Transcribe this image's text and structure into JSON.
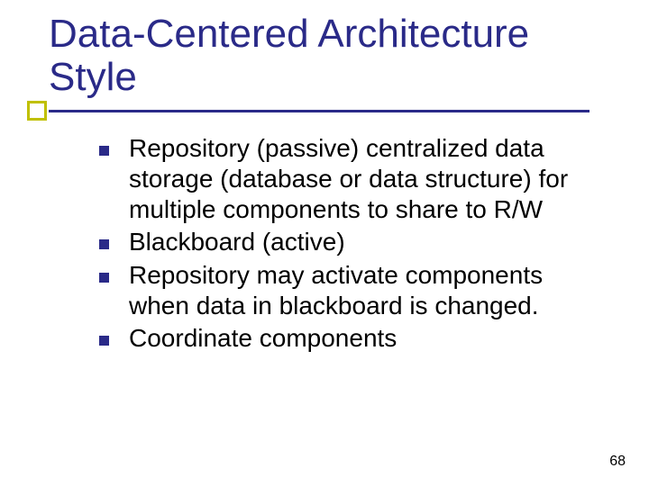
{
  "title": "Data-Centered Architecture Style",
  "bullets": [
    "Repository (passive) centralized data storage (database or data structure) for multiple components to share to R/W",
    "Blackboard (active)",
    "Repository may activate components when data in blackboard is changed.",
    "Coordinate components"
  ],
  "page_number": "68"
}
